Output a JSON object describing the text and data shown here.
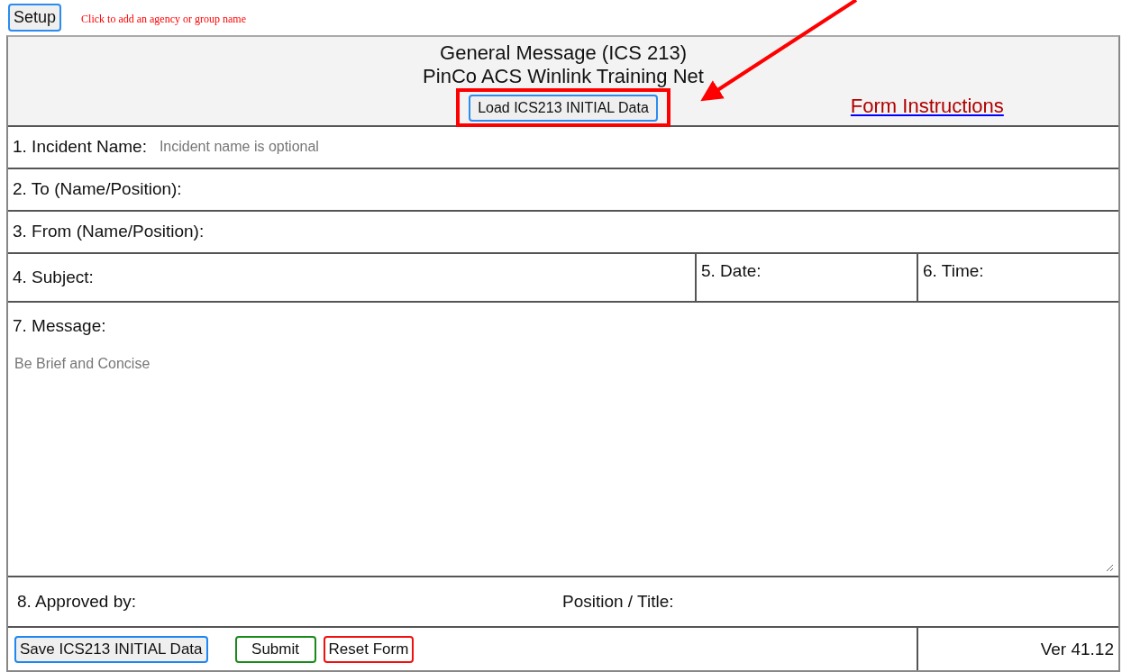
{
  "setup_button": "Setup",
  "agency_hint": "Click to add an agency or group name",
  "header": {
    "title": "General Message (ICS 213)",
    "subtitle": "PinCo ACS Winlink Training Net",
    "load_button": "Load ICS213 INITIAL Data",
    "instructions_link": "Form Instructions"
  },
  "fields": [
    {
      "label": "1. Incident Name:",
      "placeholder": "Incident name is optional"
    },
    {
      "label": "2. To (Name/Position):"
    },
    {
      "label": "3. From (Name/Position):"
    }
  ],
  "subject_row": [
    {
      "label": "4. Subject:"
    },
    {
      "label": "5. Date:"
    },
    {
      "label": "6. Time:"
    }
  ],
  "message": {
    "label": "7. Message:",
    "placeholder": "Be Brief and Concise"
  },
  "approval": [
    {
      "label": "8. Approved by:"
    },
    {
      "label": "Position / Title:"
    }
  ],
  "footer": {
    "buttons": [
      {
        "kind": "save",
        "label": "Save ICS213 INITIAL Data"
      },
      {
        "kind": "submit",
        "label": "Submit"
      },
      {
        "kind": "reset",
        "label": "Reset Form"
      }
    ],
    "version": "Ver 41.12"
  }
}
